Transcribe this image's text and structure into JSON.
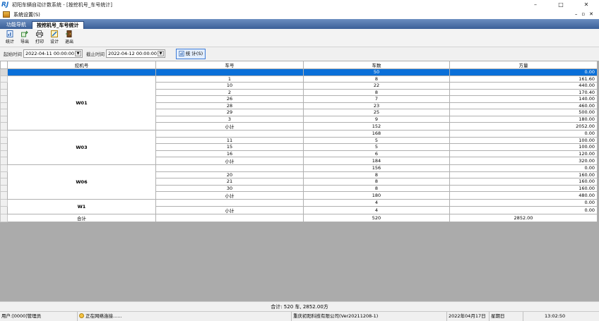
{
  "window": {
    "title": "初阳车辆自动计数系统 - [按挖机号_车号统计]",
    "logo": "RJ",
    "minimize": "–",
    "maximize": "□",
    "close": "✕"
  },
  "menu": {
    "settings": "系统设置(S)",
    "mdi_min": "–",
    "mdi_restore": "▫",
    "mdi_close": "✕"
  },
  "tabs": [
    {
      "label": "功能导航",
      "active": false
    },
    {
      "label": "按挖机号_车号统计",
      "active": true
    }
  ],
  "toolbar": {
    "stats": "统计",
    "export": "导出",
    "print": "打印",
    "design": "设计",
    "exit": "退出"
  },
  "filter": {
    "start_label": "起始时间",
    "start_value": "2022-04-11 00:00:00",
    "end_label": "截止时间",
    "end_value": "2022-04-12 00:00:00",
    "stat_button": "统 计(S)"
  },
  "table": {
    "headers": [
      "挖机号",
      "车号",
      "车数",
      "方量"
    ],
    "groups": [
      {
        "name": "",
        "rows": [
          {
            "car": "",
            "count": "50",
            "volume": "0.00"
          }
        ]
      },
      {
        "name": "W01",
        "rows": [
          {
            "car": "1",
            "count": "8",
            "volume": "161.60"
          },
          {
            "car": "10",
            "count": "22",
            "volume": "440.00"
          },
          {
            "car": "2",
            "count": "8",
            "volume": "170.40"
          },
          {
            "car": "26",
            "count": "7",
            "volume": "140.00"
          },
          {
            "car": "28",
            "count": "23",
            "volume": "460.00"
          },
          {
            "car": "29",
            "count": "25",
            "volume": "500.00"
          },
          {
            "car": "3",
            "count": "9",
            "volume": "180.00"
          },
          {
            "car": "小计",
            "count": "152",
            "volume": "2052.00"
          }
        ]
      },
      {
        "name": "W03",
        "rows": [
          {
            "car": "",
            "count": "168",
            "volume": "0.00"
          },
          {
            "car": "11",
            "count": "5",
            "volume": "100.00"
          },
          {
            "car": "15",
            "count": "5",
            "volume": "100.00"
          },
          {
            "car": "16",
            "count": "6",
            "volume": "120.00"
          },
          {
            "car": "小计",
            "count": "184",
            "volume": "320.00"
          }
        ]
      },
      {
        "name": "W06",
        "rows": [
          {
            "car": "",
            "count": "156",
            "volume": "0.00"
          },
          {
            "car": "20",
            "count": "8",
            "volume": "160.00"
          },
          {
            "car": "21",
            "count": "8",
            "volume": "160.00"
          },
          {
            "car": "30",
            "count": "8",
            "volume": "160.00"
          },
          {
            "car": "小计",
            "count": "180",
            "volume": "480.00"
          }
        ]
      },
      {
        "name": "W1",
        "rows": [
          {
            "car": "",
            "count": "4",
            "volume": "0.00"
          },
          {
            "car": "小计",
            "count": "4",
            "volume": "0.00"
          }
        ]
      }
    ],
    "total": {
      "label": "合计",
      "car": "",
      "count": "520",
      "volume": "2852.00"
    }
  },
  "summary": "合计: 520 车, 2852.00方",
  "status": {
    "user": "用户:[0000]管理员",
    "network": "正在网络连接......",
    "company": "重庆初阳科技有限公司(Ver20211208-1)",
    "date": "2022年04月17日",
    "weekday": "星期日",
    "time": "13:02:50"
  }
}
